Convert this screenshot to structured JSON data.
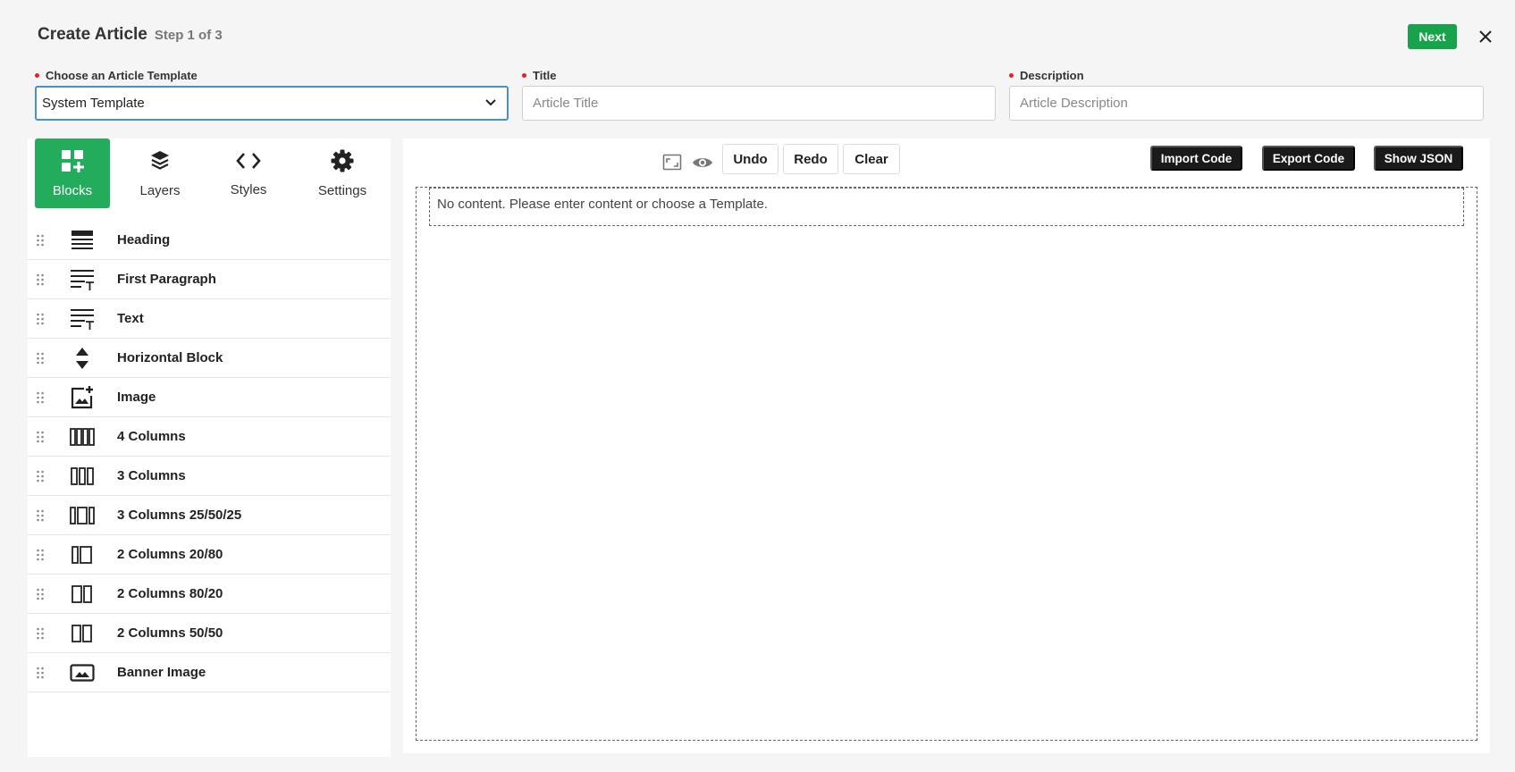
{
  "header": {
    "title": "Create Article",
    "step": "Step 1 of 3",
    "next_label": "Next"
  },
  "form": {
    "template": {
      "label": "Choose an Article Template",
      "value": "System Template"
    },
    "title": {
      "label": "Title",
      "placeholder": "Article Title"
    },
    "description": {
      "label": "Description",
      "placeholder": "Article Description"
    }
  },
  "tabs": [
    {
      "label": "Blocks",
      "icon": "blocks-icon",
      "active": true
    },
    {
      "label": "Layers",
      "icon": "layers-icon",
      "active": false
    },
    {
      "label": "Styles",
      "icon": "code-icon",
      "active": false
    },
    {
      "label": "Settings",
      "icon": "gear-icon",
      "active": false
    }
  ],
  "blocks": [
    {
      "label": "Heading",
      "icon": "heading-icon"
    },
    {
      "label": "First Paragraph",
      "icon": "paragraph-icon"
    },
    {
      "label": "Text",
      "icon": "text-icon"
    },
    {
      "label": "Horizontal Block",
      "icon": "horizontal-block-icon"
    },
    {
      "label": "Image",
      "icon": "image-icon"
    },
    {
      "label": "4 Columns",
      "icon": "four-columns-icon"
    },
    {
      "label": "3 Columns",
      "icon": "three-columns-icon"
    },
    {
      "label": "3 Columns 25/50/25",
      "icon": "three-columns-25-50-25-icon"
    },
    {
      "label": "2 Columns 20/80",
      "icon": "two-columns-20-80-icon"
    },
    {
      "label": "2 Columns 80/20",
      "icon": "two-columns-80-20-icon"
    },
    {
      "label": "2 Columns 50/50",
      "icon": "two-columns-50-50-icon"
    },
    {
      "label": "Banner Image",
      "icon": "banner-image-icon"
    }
  ],
  "toolbar": {
    "undo": "Undo",
    "redo": "Redo",
    "clear": "Clear",
    "import": "Import Code",
    "export": "Export Code",
    "json": "Show JSON"
  },
  "canvas": {
    "empty_message": "No content. Please enter content or choose a Template."
  },
  "colors": {
    "accent": "#16a34a",
    "tab_active": "#22ac5c",
    "required": "#dc2626",
    "dark_button": "#1a1a1a"
  }
}
